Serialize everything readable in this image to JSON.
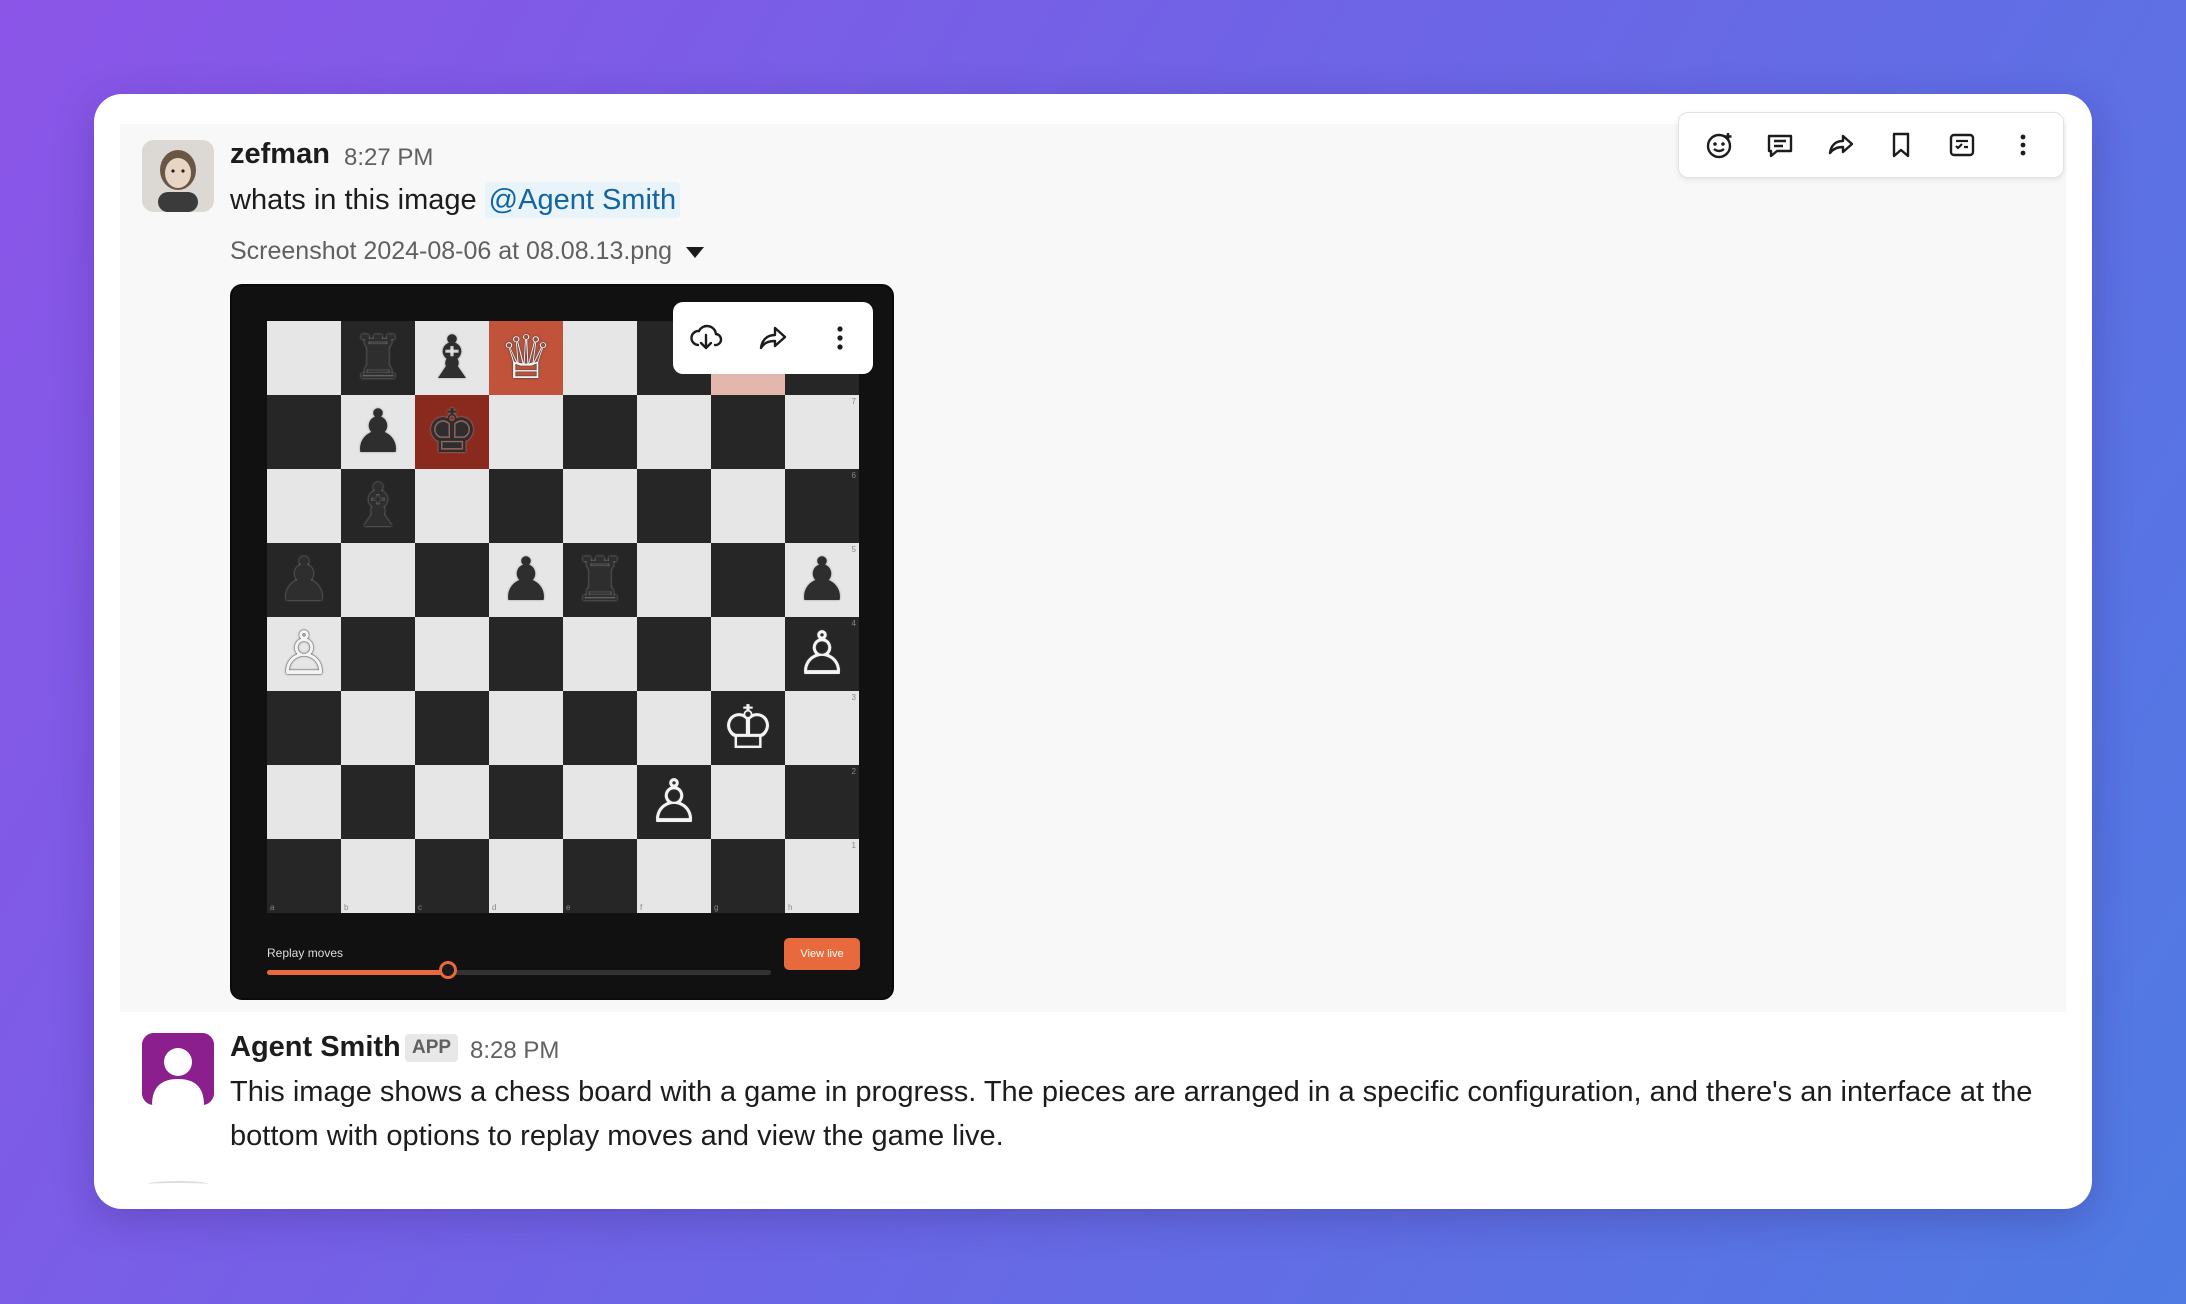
{
  "messages": [
    {
      "author": "zefman",
      "time": "8:27 PM",
      "text": "whats in this image ",
      "mention": "@Agent Smith",
      "attachment": {
        "filename": "Screenshot 2024-08-06 at 08.08.13.png",
        "replay_label": "Replay moves",
        "view_live_label": "View live",
        "replay_progress": 0.36
      }
    },
    {
      "author": "Agent Smith",
      "badge": "APP",
      "time": "8:28 PM",
      "text": "This image shows a chess board with a game in progress. The pieces are arranged in a specific configuration, and there's an interface at the bottom with options to replay moves and view the game live."
    }
  ],
  "message_toolbar": [
    "add-reaction-icon",
    "reply-in-thread-icon",
    "forward-icon",
    "save-bookmark-icon",
    "add-to-list-icon",
    "more-actions-icon"
  ],
  "image_toolbar": [
    "download-icon",
    "share-icon",
    "more-icon"
  ],
  "board": {
    "files": [
      "a",
      "b",
      "c",
      "d",
      "e",
      "f",
      "g",
      "h"
    ],
    "ranks": [
      "8",
      "7",
      "6",
      "5",
      "4",
      "3",
      "2",
      "1"
    ],
    "rows": [
      [
        "",
        "♜",
        "♝",
        "♕",
        "",
        "",
        "",
        ""
      ],
      [
        "",
        "♟",
        "♚",
        "",
        "",
        "",
        "",
        ""
      ],
      [
        "",
        "♝",
        "",
        "",
        "",
        "",
        "",
        ""
      ],
      [
        "♟",
        "",
        "",
        "♟",
        "♜",
        "",
        "",
        "♟"
      ],
      [
        "♙",
        "",
        "",
        "",
        "",
        "",
        "",
        "♙"
      ],
      [
        "",
        "",
        "",
        "",
        "",
        "",
        "♔",
        ""
      ],
      [
        "",
        "",
        "",
        "",
        "",
        "♙",
        "",
        ""
      ],
      [
        "",
        "",
        "",
        "",
        "",
        "",
        "",
        ""
      ]
    ]
  },
  "colors": {
    "mention_bg": "#e8f3fa",
    "mention_text": "#1264a3",
    "accent_orange": "#e8693c",
    "agent_avatar": "#8a1f8d"
  }
}
